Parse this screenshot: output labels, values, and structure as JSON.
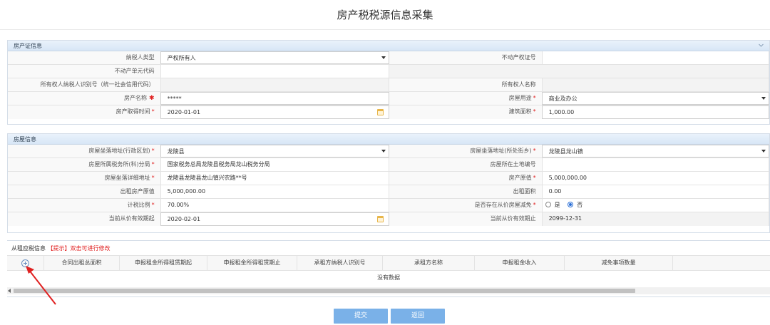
{
  "page": {
    "title": "房产税税源信息采集"
  },
  "section1": {
    "title": "房产证信息",
    "taxpayer_type_label": "纳税人类型",
    "taxpayer_type_value": "产权所有人",
    "property_cert_label": "不动产权证号",
    "property_cert_value": "",
    "unit_code_label": "不动产单元代码",
    "unit_code_value": "",
    "owner_id_label": "所有权人纳税人识别号（统一社会信用代码）",
    "owner_id_value": "",
    "owner_name_label": "所有权人名称",
    "owner_name_value": "",
    "property_name_label": "房产名称",
    "property_name_value": "*****",
    "house_use_label": "房屋用途",
    "house_use_value": "商业及办公",
    "acquire_time_label": "房产取得时间",
    "acquire_time_value": "2020-01-01",
    "build_area_label": "建筑面积",
    "build_area_value": "1,000.00"
  },
  "section2": {
    "title": "房屋信息",
    "region_label": "房屋坐落地址(行政区划)",
    "region_value": "龙陵县",
    "street_label": "房屋坐落地址(所处街乡)",
    "street_value": "龙陵县龙山镇",
    "tax_office_label": "房屋所属税务所(科)分局",
    "tax_office_value": "国家税务总局龙陵县税务局龙山税务分局",
    "land_no_label": "房屋所在土地编号",
    "land_no_value": "",
    "detail_addr_label": "房屋坐落详细地址",
    "detail_addr_value": "龙陵县龙陵县龙山镇兴农路**号",
    "orig_value_label": "房产原值",
    "orig_value_value": "5,000,000.00",
    "rent_orig_label": "出租房产原值",
    "rent_orig_value": "5,000,000.00",
    "rent_area_label": "出租面积",
    "rent_area_value": "0.00",
    "tax_ratio_label": "计税比例",
    "tax_ratio_value": "70.00%",
    "relief_label": "是否存在从价房屋减免",
    "relief_yes": "是",
    "relief_no": "否",
    "relief_selected": "否",
    "valid_start_label": "当前从价有效期起",
    "valid_start_value": "2020-02-01",
    "valid_end_label": "当前从价有效期止",
    "valid_end_value": "2099-12-31"
  },
  "section3": {
    "title": "从租应税信息",
    "hint": "【提示】双击可进行修改",
    "columns": [
      "合同出租总面积",
      "申报租金所得租赁期起",
      "申报租金所得租赁期止",
      "承租方纳税人识别号",
      "承租方名称",
      "申报租金收入",
      "减免事项数量"
    ],
    "empty_text": "没有数据"
  },
  "buttons": {
    "submit": "提交",
    "back": "返回"
  },
  "colors": {
    "header_bg": "#d7e6f6",
    "button": "#7ab1e8",
    "required": "#e02020"
  }
}
